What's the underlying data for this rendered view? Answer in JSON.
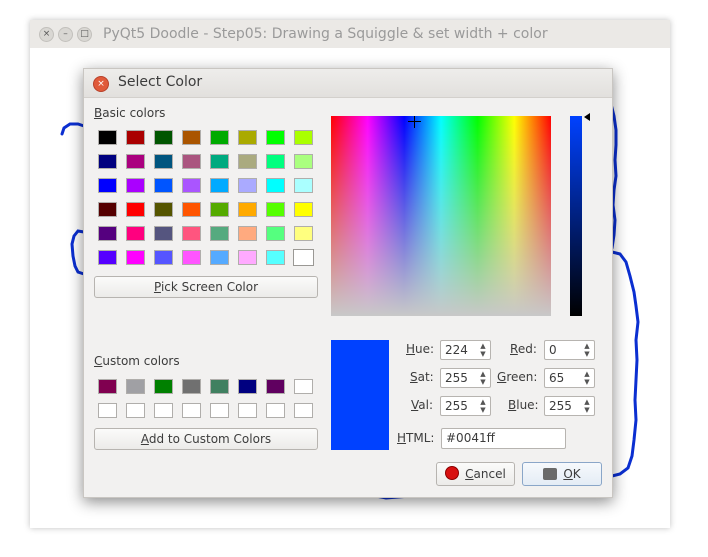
{
  "window": {
    "title": "PyQt5 Doodle - Step05: Drawing a Squiggle & set width + color",
    "controls": {
      "close": "×",
      "minimize": "–",
      "maximize": "□"
    }
  },
  "dialog": {
    "title": "Select Color",
    "close_glyph": "×",
    "basic_colors_label": {
      "accel": "B",
      "rest": "asic colors"
    },
    "basic_colors": [
      [
        "#000000",
        "#aa0000",
        "#005500",
        "#aa5500",
        "#00aa00",
        "#aaaa00",
        "#00ff00",
        "#aaff00"
      ],
      [
        "#00007f",
        "#aa007f",
        "#00557f",
        "#aa557f",
        "#00aa7f",
        "#aaaa7f",
        "#00ff7f",
        "#aaff7f"
      ],
      [
        "#0000ff",
        "#aa00ff",
        "#0055ff",
        "#aa55ff",
        "#00aaff",
        "#aaaaff",
        "#00ffff",
        "#aaffff"
      ],
      [
        "#550000",
        "#ff0000",
        "#555500",
        "#ff5500",
        "#55aa00",
        "#ffaa00",
        "#55ff00",
        "#ffff00"
      ],
      [
        "#55007f",
        "#ff007f",
        "#55557f",
        "#ff557f",
        "#55aa7f",
        "#ffaa7f",
        "#55ff7f",
        "#ffff7f"
      ],
      [
        "#5500ff",
        "#ff00ff",
        "#5555ff",
        "#ff55ff",
        "#55aaff",
        "#ffaaff",
        "#55ffff",
        "#ffffff"
      ]
    ],
    "pick_screen_color": {
      "accel": "P",
      "rest": "ick Screen Color"
    },
    "custom_colors_label": {
      "accel": "C",
      "rest": "ustom colors"
    },
    "custom_colors": [
      [
        "#800050",
        "#a0a0a4",
        "#008000",
        "#707070",
        "#408060",
        "#000080",
        "#600060",
        "#ffffff"
      ],
      [
        "#ffffff",
        "#ffffff",
        "#ffffff",
        "#ffffff",
        "#ffffff",
        "#ffffff",
        "#ffffff",
        "#ffffff"
      ]
    ],
    "add_to_custom": {
      "accel": "A",
      "rest": "dd to Custom Colors"
    },
    "current_color": "#0041ff",
    "fields": {
      "hue": {
        "accel": "H",
        "rest": "ue:",
        "value": "224"
      },
      "sat": {
        "accel": "S",
        "rest": "at:",
        "value": "255"
      },
      "val": {
        "accel": "V",
        "rest": "al:",
        "value": "255"
      },
      "red": {
        "accel": "R",
        "rest": "ed:",
        "value": "0"
      },
      "green": {
        "accel": "G",
        "rest": "reen:",
        "value": "65"
      },
      "blue": {
        "accel": "B",
        "rest": "lue:",
        "value": "255"
      },
      "html": {
        "accel": "H",
        "rest": "TML:",
        "value": "#0041ff"
      }
    },
    "cancel": {
      "accel": "C",
      "rest": "ancel"
    },
    "ok": {
      "accel": "O",
      "rest": "K"
    },
    "spin_arrows": {
      "up": "▲",
      "down": "▼"
    }
  }
}
